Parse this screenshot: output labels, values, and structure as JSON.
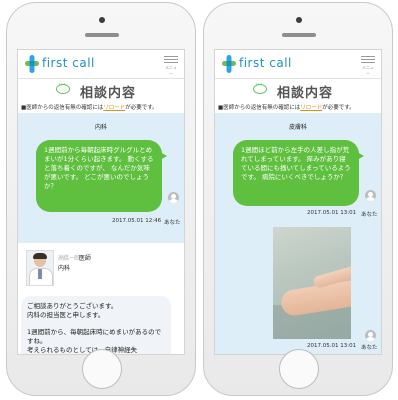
{
  "app": {
    "brand": "first call",
    "menu_label": "メニュー"
  },
  "colors": {
    "brand": "#1f8ec9",
    "bubble": "#5fbf3f",
    "chat_bg": "#ddeef8",
    "link": "#e0901b"
  },
  "left_screen": {
    "page_title": "相談内容",
    "notice_prefix": "■医師からの返信有無の確認には",
    "notice_link": "リロード",
    "notice_suffix": "が必要です。",
    "department": "内科",
    "message": "1週間前から毎朝起床時グルグルとめまいが1分くらい起きます。 動くすると落ち着くのですが、 なんだか気味が悪いです。 どこが悪いのでしょうか？",
    "timestamp": "2017.05.01 12:46",
    "sender": "あなた",
    "doctor_name_hidden": "高橋 一郎",
    "doctor_title": "医師",
    "doctor_department": "内科",
    "reply_lines": [
      "ご相談ありがとうございます。",
      "内科の担当医と申します。",
      "1週間前から、毎朝起床時にめまいがあるのですね。",
      "考えられるものとしては、自律神経失"
    ]
  },
  "right_screen": {
    "page_title": "相談内容",
    "notice_prefix": "■医師からの返信有無の確認には",
    "notice_link": "リロード",
    "notice_suffix": "が必要です。",
    "department": "皮膚科",
    "message": "1週間ほど前から左手の人差し指が荒れてしまっています。 痒みがあり寝ている間にも掻いてしまっているようです。 病院にいくべきでしょうか？",
    "timestamp_1": "2017.05.01 13:01",
    "sender_1": "あなた",
    "timestamp_2": "2017.05.01 13:01",
    "sender_2": "あなた"
  }
}
